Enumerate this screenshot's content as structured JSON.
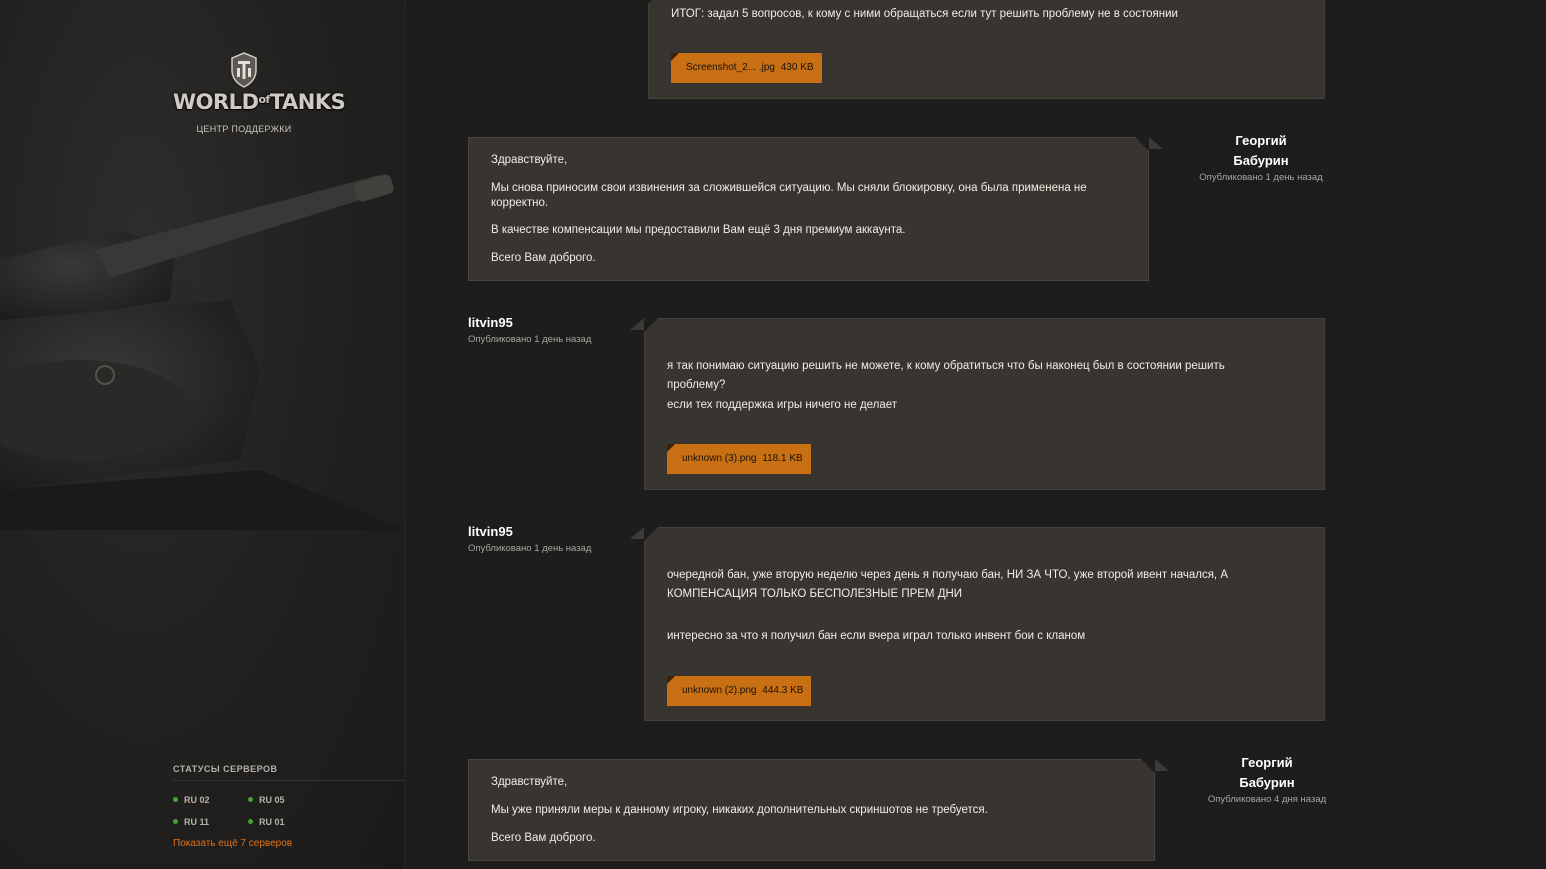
{
  "sidebar": {
    "logo_text_a": "WORLD",
    "logo_text_of": "of",
    "logo_text_b": "TANKS",
    "support_caption": "ЦЕНТР ПОДДЕРЖКИ",
    "servers_title": "СТАТУСЫ СЕРВЕРОВ",
    "servers": [
      {
        "name": "RU 02",
        "status_color": "#4a9f3a"
      },
      {
        "name": "RU 05",
        "status_color": "#4a9f3a"
      },
      {
        "name": "RU 11",
        "status_color": "#4a9f3a"
      },
      {
        "name": "RU 01",
        "status_color": "#4a9f3a"
      }
    ],
    "show_more": "Показать ещё 7 серверов"
  },
  "messages": [
    {
      "lines": [
        "ИТОГ: задал 5 вопросов, к кому с ними обращаться если тут решить проблему не в состоянии"
      ],
      "attachment": {
        "name": "Screenshot_2... .jpg",
        "size": "430 KB"
      }
    },
    {
      "author": "Георгий Бабурин",
      "author_line1": "Георгий",
      "author_line2": "Бабурин",
      "time": "Опубликовано 1 день назад",
      "lines": [
        "Здравствуйте,",
        "Мы снова приносим свои извинения за сложившейся ситуацию. Мы сняли блокировку, она была применена не",
        "корректно.",
        "В качестве компенсации мы предоставили Вам ещё 3 дня премиум аккаунта.",
        "Всего Вам доброго."
      ]
    },
    {
      "author": "litvin95",
      "time": "Опубликовано 1 день назад",
      "lines": [
        "я так понимаю ситуацию решить не можете, к кому обратиться что бы наконец был в состоянии решить",
        "проблему?",
        "если тех поддержка игры ничего не делает"
      ],
      "attachment": {
        "name": "unknown (3).png",
        "size": "118.1 KB"
      }
    },
    {
      "author": "litvin95",
      "time": "Опубликовано 1 день назад",
      "lines": [
        "очередной бан, уже вторую неделю через день я получаю бан, НИ ЗА ЧТО, уже второй ивент начался, А",
        "КОМПЕНСАЦИЯ ТОЛЬКО БЕСПОЛЕЗНЫЕ ПРЕМ ДНИ",
        "интересно за что я получил бан если вчера играл только инвент бои с кланом"
      ],
      "attachment": {
        "name": "unknown (2).png",
        "size": "444.3 KB"
      }
    },
    {
      "author": "Георгий Бабурин",
      "author_line1": "Георгий",
      "author_line2": "Бабурин",
      "time": "Опубликовано 4 дня назад",
      "lines": [
        "Здравствуйте,",
        "Мы уже приняли меры к данному игроку, никаких дополнительных скриншотов не требуется.",
        "Всего Вам доброго."
      ]
    }
  ],
  "colors": {
    "accent": "#c96f14",
    "card_bg": "#38342f",
    "page_bg": "#1d1d1d",
    "link": "#e0721a"
  }
}
